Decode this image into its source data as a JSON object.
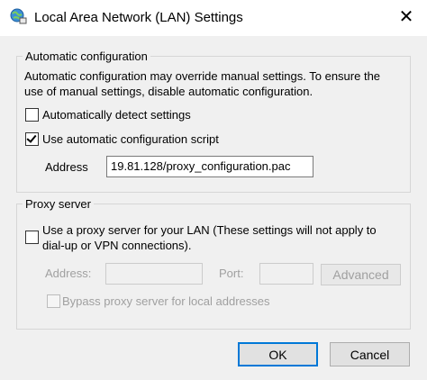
{
  "window": {
    "title": "Local Area Network (LAN) Settings",
    "close_glyph": "✕"
  },
  "auto_config": {
    "legend": "Automatic configuration",
    "description_line1": "Automatic configuration may override manual settings.  To ensure the",
    "description_line2": "use of manual settings, disable automatic configuration.",
    "detect_label": "Automatically detect settings",
    "detect_checked": false,
    "script_label": "Use automatic configuration script",
    "script_checked": true,
    "address_label": "Address",
    "address_value": "19.81.128/proxy_configuration.pac"
  },
  "proxy": {
    "legend": "Proxy server",
    "use_proxy_line1": "Use a proxy server for your LAN (These settings will not apply to",
    "use_proxy_line2": "dial-up or VPN connections).",
    "use_proxy_checked": false,
    "address_label": "Address:",
    "address_value": "",
    "port_label": "Port:",
    "port_value": "",
    "advanced_label": "Advanced",
    "bypass_label": "Bypass proxy server for local addresses",
    "bypass_checked": false
  },
  "buttons": {
    "ok": "OK",
    "cancel": "Cancel"
  }
}
